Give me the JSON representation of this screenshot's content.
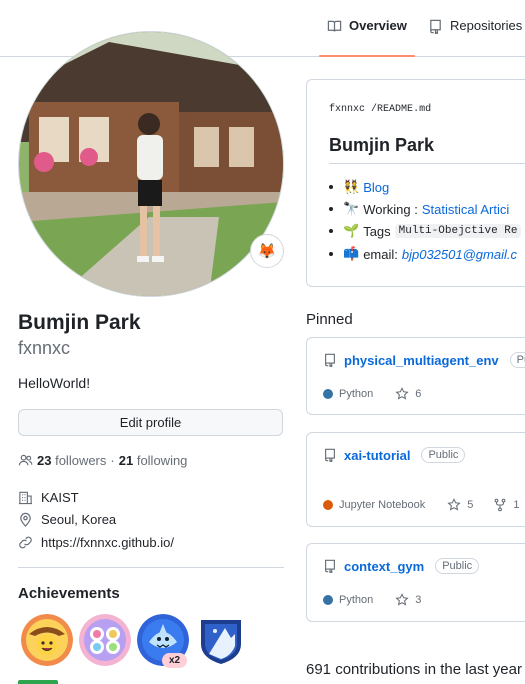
{
  "nav": {
    "tabs": [
      {
        "label": "Overview",
        "icon": "book-icon",
        "selected": true
      },
      {
        "label": "Repositories",
        "icon": "repo-icon",
        "selected": false
      }
    ]
  },
  "profile": {
    "full_name": "Bumjin Park",
    "username": "fxnnxc",
    "bio": "HelloWorld!",
    "status_emoji": "🦊",
    "edit_label": "Edit profile",
    "followers_count": "23",
    "followers_label": "followers",
    "separator": "·",
    "following_count": "21",
    "following_label": "following",
    "organization": "KAIST",
    "location": "Seoul, Korea",
    "website": "https://fxnnxc.github.io/"
  },
  "achievements": {
    "title": "Achievements",
    "badges": [
      "cowboy-badge",
      "yolo-badge",
      "shark-badge",
      "arctic-badge"
    ],
    "shark_multiplier": "x2"
  },
  "readme": {
    "path_user": "fxnnxc",
    "path_sep": "/",
    "path_file": "README",
    "path_ext": ".md",
    "title": "Bumjin Park",
    "items": [
      {
        "emoji": "👯",
        "prefix": "",
        "link": "Blog",
        "code": ""
      },
      {
        "emoji": "🔭",
        "prefix": "Working :",
        "link": "Statistical Artici",
        "code": ""
      },
      {
        "emoji": "🌱",
        "prefix": "Tags",
        "link": "",
        "code": "Multi-Obejctive Re"
      },
      {
        "emoji": "📫",
        "prefix": "email:",
        "link": "bjp032501@gmail.c",
        "code": ""
      }
    ]
  },
  "pinned": {
    "title": "Pinned",
    "repos": [
      {
        "name": "physical_multiagent_env",
        "visibility": "Pub",
        "language": "Python",
        "lang_color": "#3572A5",
        "stars": "6",
        "forks": ""
      },
      {
        "name": "xai-tutorial",
        "visibility": "Public",
        "language": "Jupyter Notebook",
        "lang_color": "#DA5B0B",
        "stars": "5",
        "forks": "1"
      },
      {
        "name": "context_gym",
        "visibility": "Public",
        "language": "Python",
        "lang_color": "#3572A5",
        "stars": "3",
        "forks": ""
      }
    ]
  },
  "contributions": "691 contributions in the last year"
}
